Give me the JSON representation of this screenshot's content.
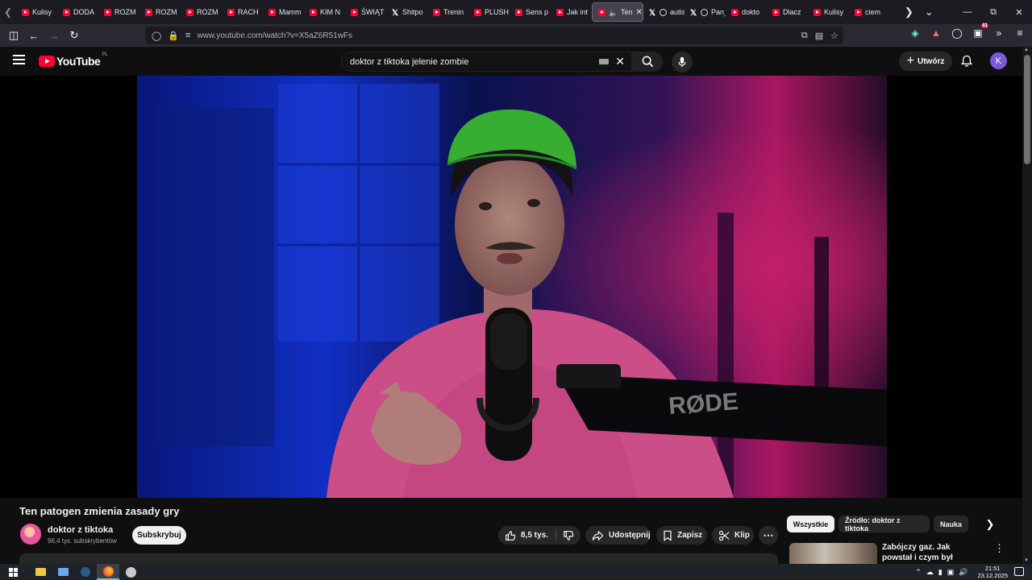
{
  "browser": {
    "tabs": [
      {
        "label": "Kulisy",
        "icon": "youtube-icon"
      },
      {
        "label": "DODA",
        "icon": "youtube-icon"
      },
      {
        "label": "ROZM",
        "icon": "youtube-icon"
      },
      {
        "label": "ROZM",
        "icon": "youtube-icon"
      },
      {
        "label": "ROZM",
        "icon": "youtube-icon"
      },
      {
        "label": "RACH",
        "icon": "youtube-icon"
      },
      {
        "label": "Mamm",
        "icon": "youtube-icon"
      },
      {
        "label": "KIM N",
        "icon": "youtube-icon"
      },
      {
        "label": "ŚWIĄT",
        "icon": "youtube-icon"
      },
      {
        "label": "Shitpo",
        "icon": "x-icon"
      },
      {
        "label": "Trenin",
        "icon": "youtube-icon"
      },
      {
        "label": "PLUSH",
        "icon": "youtube-icon"
      },
      {
        "label": "Sens p",
        "icon": "youtube-icon"
      },
      {
        "label": "Jak int",
        "icon": "youtube-icon"
      },
      {
        "label": "Ten",
        "icon": "youtube-icon",
        "active": true
      },
      {
        "label": "autist",
        "icon": "x-icon"
      },
      {
        "label": "Pan_k",
        "icon": "x-icon"
      },
      {
        "label": "dokto",
        "icon": "youtube-icon"
      },
      {
        "label": "Dlacz",
        "icon": "youtube-icon"
      },
      {
        "label": "Kulisy",
        "icon": "youtube-icon"
      },
      {
        "label": "ciem",
        "icon": "youtube-icon"
      }
    ],
    "url": "www.youtube.com/watch?v=X5aZ6R51wFs",
    "extension_badge": "81"
  },
  "youtube": {
    "logo_text": "YouTube",
    "country_code": "PL",
    "search_query": "doktor z tiktoka jelenie zombie",
    "create_label": "Utwórz",
    "avatar_letter": "K",
    "accent_color": "#ff0033"
  },
  "video": {
    "title": "Ten patogen zmienia zasady gry",
    "channel_name": "doktor z tiktoka",
    "channel_subs": "96,4 tys. subskrybentów",
    "subscribe_label": "Subskrybuj",
    "like_count": "8,5 tys.",
    "share_label": "Udostępnij",
    "save_label": "Zapisz",
    "clip_label": "Klip",
    "mic_brand": "RØDE"
  },
  "sidebar": {
    "chips": [
      "Wszystkie",
      "Źródło: doktor z tiktoka",
      "Nauka"
    ],
    "recommendation_title": "Zabójczy gaz. Jak powstał i czym był Cyklon B?"
  },
  "taskbar": {
    "time": "21:51",
    "date": "23.12.2025"
  }
}
